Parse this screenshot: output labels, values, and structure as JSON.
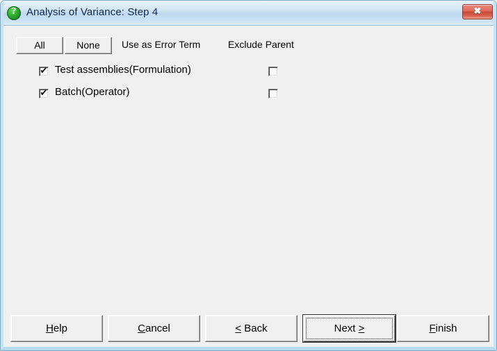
{
  "window": {
    "title": "Analysis of Variance: Step 4",
    "icon": "question-mark-icon",
    "close_label": "✖",
    "accent_title_color": "#0b2a49",
    "close_button_color": "#c84a38"
  },
  "toolbar": {
    "all_label": "All",
    "none_label": "None",
    "column_error_term": "Use as Error Term",
    "column_exclude_parent": "Exclude Parent"
  },
  "terms": [
    {
      "label": "Test assemblies(Formulation)",
      "use_as_error_term": true,
      "exclude_parent": false,
      "checked_glyph": "✔",
      "unchecked_glyph": ""
    },
    {
      "label": "Batch(Operator)",
      "use_as_error_term": true,
      "exclude_parent": false,
      "checked_glyph": "✔",
      "unchecked_glyph": ""
    }
  ],
  "buttons": {
    "help": {
      "pre": "",
      "mnemonic": "H",
      "post": "elp"
    },
    "cancel": {
      "pre": "",
      "mnemonic": "C",
      "post": "ancel"
    },
    "back": {
      "pre": "",
      "mnemonic": "<",
      "post": " Back"
    },
    "next": {
      "pre": "Next ",
      "mnemonic": ">",
      "post": ""
    },
    "finish": {
      "pre": "",
      "mnemonic": "F",
      "post": "inish"
    },
    "default_button": "next"
  }
}
